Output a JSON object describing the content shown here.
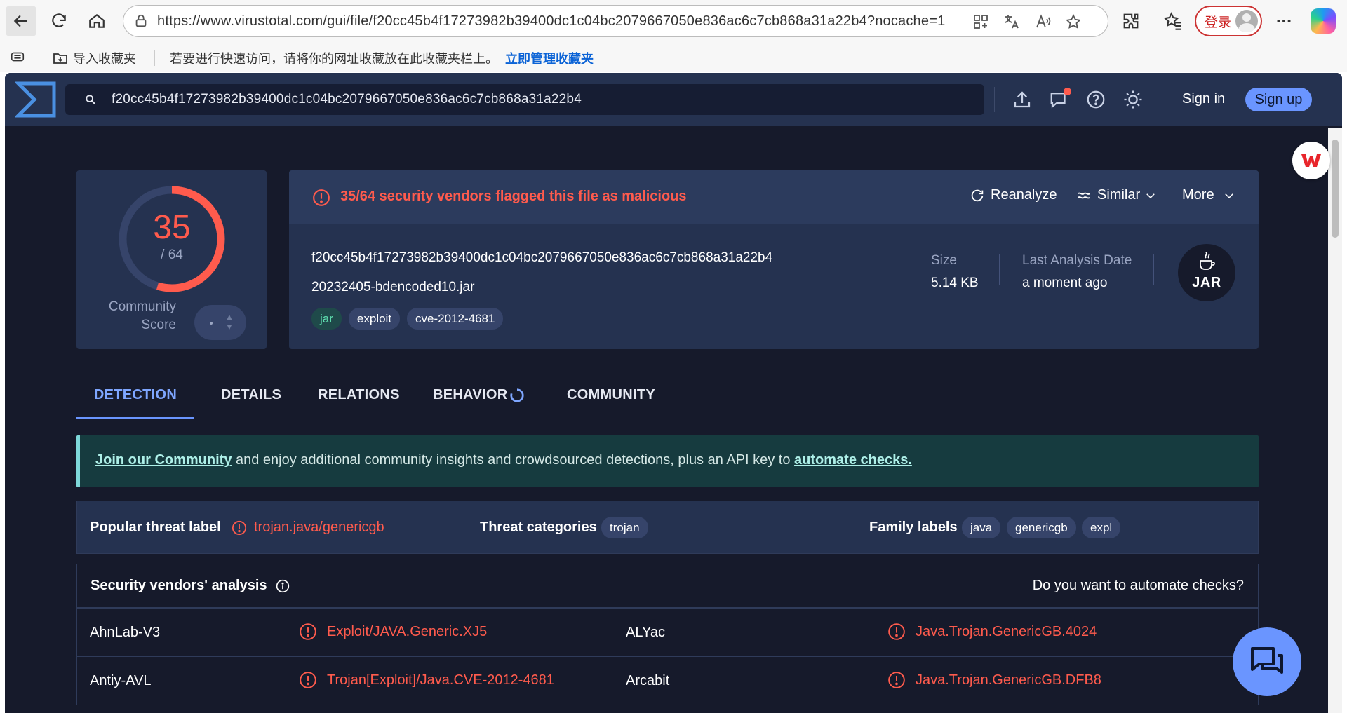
{
  "browser": {
    "url": "https://www.virustotal.com/gui/file/f20cc45b4f17273982b39400dc1c04bc2079667050e836ac6c7cb868a31a22b4?nocache=1",
    "login_label": "登录",
    "bookmarks": {
      "import_label": "导入收藏夹",
      "hint": "若要进行快速访问，请将你的网址收藏放在此收藏夹栏上。",
      "manage_link": "立即管理收藏夹"
    }
  },
  "header": {
    "search_value": "f20cc45b4f17273982b39400dc1c04bc2079667050e836ac6c7cb868a31a22b4",
    "sign_in": "Sign in",
    "sign_up": "Sign up"
  },
  "score": {
    "detections": "35",
    "total": "/ 64",
    "detection_fraction": 0.547,
    "community_label": "Community Score",
    "community_value": "-"
  },
  "summary": {
    "flag_text": "35/64 security vendors flagged this file as malicious",
    "actions": {
      "reanalyze": "Reanalyze",
      "similar": "Similar",
      "more": "More"
    },
    "hash": "f20cc45b4f17273982b39400dc1c04bc2079667050e836ac6c7cb868a31a22b4",
    "filename": "20232405-bdencoded10.jar",
    "tags": [
      "jar",
      "exploit",
      "cve-2012-4681"
    ],
    "size_label": "Size",
    "size_value": "5.14 KB",
    "last_analysis_label": "Last Analysis Date",
    "last_analysis_value": "a moment ago",
    "filetype_icon": "JAR"
  },
  "tabs": [
    "DETECTION",
    "DETAILS",
    "RELATIONS",
    "BEHAVIOR",
    "COMMUNITY"
  ],
  "banner": {
    "join_link": "Join our Community",
    "middle_text": " and enjoy additional community insights and crowdsourced detections, plus an API key to ",
    "automate_link": "automate checks."
  },
  "threat": {
    "popular_label": "Popular threat label",
    "popular_value": "trojan.java/genericgb",
    "categories_label": "Threat categories",
    "categories": [
      "trojan"
    ],
    "family_label": "Family labels",
    "families": [
      "java",
      "genericgb",
      "expl"
    ]
  },
  "vendors": {
    "title": "Security vendors' analysis",
    "automate_question": "Do you want to automate checks?",
    "rows": [
      {
        "left_name": "AhnLab-V3",
        "left_result": "Exploit/JAVA.Generic.XJ5",
        "right_name": "ALYac",
        "right_result": "Java.Trojan.GenericGB.4024"
      },
      {
        "left_name": "Antiy-AVL",
        "left_result": "Trojan[Exploit]/Java.CVE-2012-4681",
        "right_name": "Arcabit",
        "right_result": "Java.Trojan.GenericGB.DFB8"
      }
    ]
  },
  "colors": {
    "malicious": "#ff5b4d",
    "accent": "#6a95ff",
    "header_bg": "#253250",
    "page_bg": "#161a2b"
  }
}
